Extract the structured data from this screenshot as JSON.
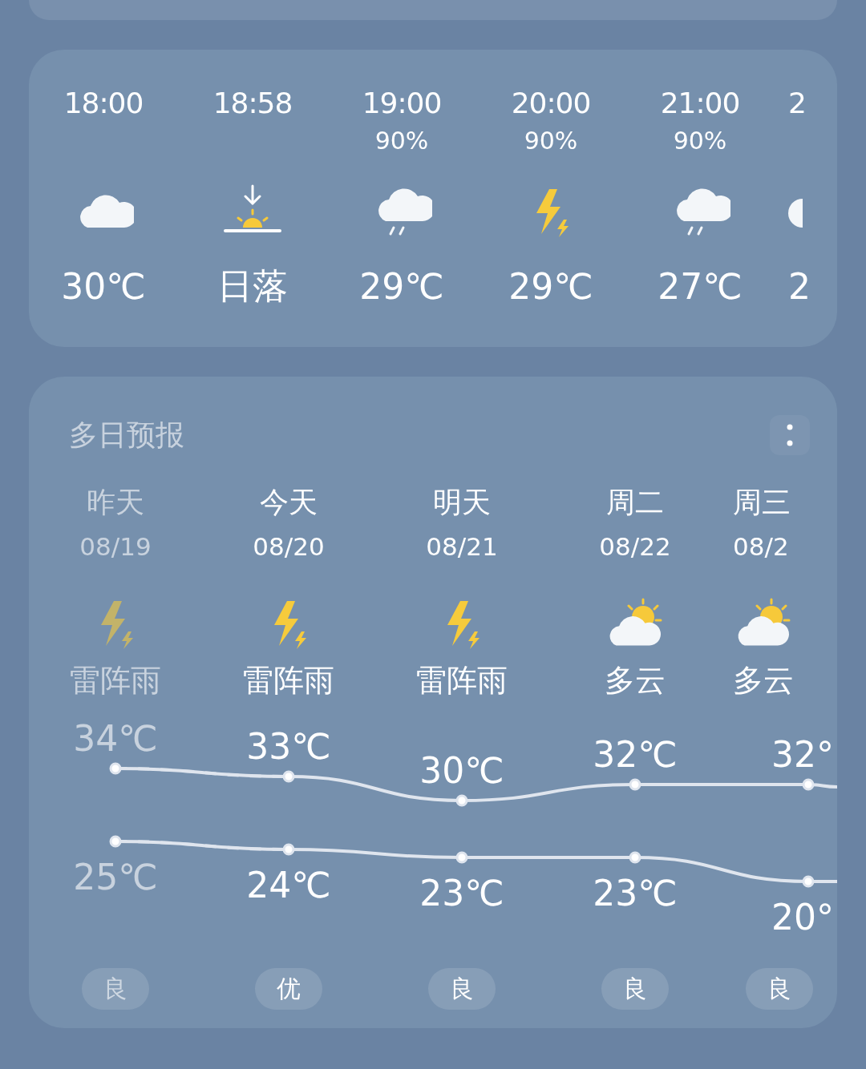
{
  "hourly": [
    {
      "time": "18:00",
      "kind": "cloudy",
      "value": "30℃"
    },
    {
      "time": "18:58",
      "kind": "sunset",
      "value": "日落"
    },
    {
      "time": "19:00",
      "precip": "90%",
      "kind": "rain",
      "value": "29℃"
    },
    {
      "time": "20:00",
      "precip": "90%",
      "kind": "thunder",
      "value": "29℃"
    },
    {
      "time": "21:00",
      "precip": "90%",
      "kind": "rain",
      "value": "27℃"
    },
    {
      "time": "2",
      "kind": "cloudy",
      "value": "2"
    }
  ],
  "forecast": {
    "title": "多日预报",
    "days": [
      {
        "name": "昨天",
        "date": "08/19",
        "kind": "thunder",
        "weather": "雷阵雨",
        "high": "34℃",
        "low": "25℃",
        "aqi": "良",
        "past": true
      },
      {
        "name": "今天",
        "date": "08/20",
        "kind": "thunder",
        "weather": "雷阵雨",
        "high": "33℃",
        "low": "24℃",
        "aqi": "优",
        "past": false
      },
      {
        "name": "明天",
        "date": "08/21",
        "kind": "thunder",
        "weather": "雷阵雨",
        "high": "30℃",
        "low": "23℃",
        "aqi": "良",
        "past": false
      },
      {
        "name": "周二",
        "date": "08/22",
        "kind": "partly",
        "weather": "多云",
        "high": "32℃",
        "low": "23℃",
        "aqi": "良",
        "past": false
      },
      {
        "name": "周三",
        "date": "08/2",
        "kind": "partly",
        "weather": "多云",
        "high": "32°",
        "low": "20°",
        "aqi": "良",
        "past": false
      }
    ]
  }
}
